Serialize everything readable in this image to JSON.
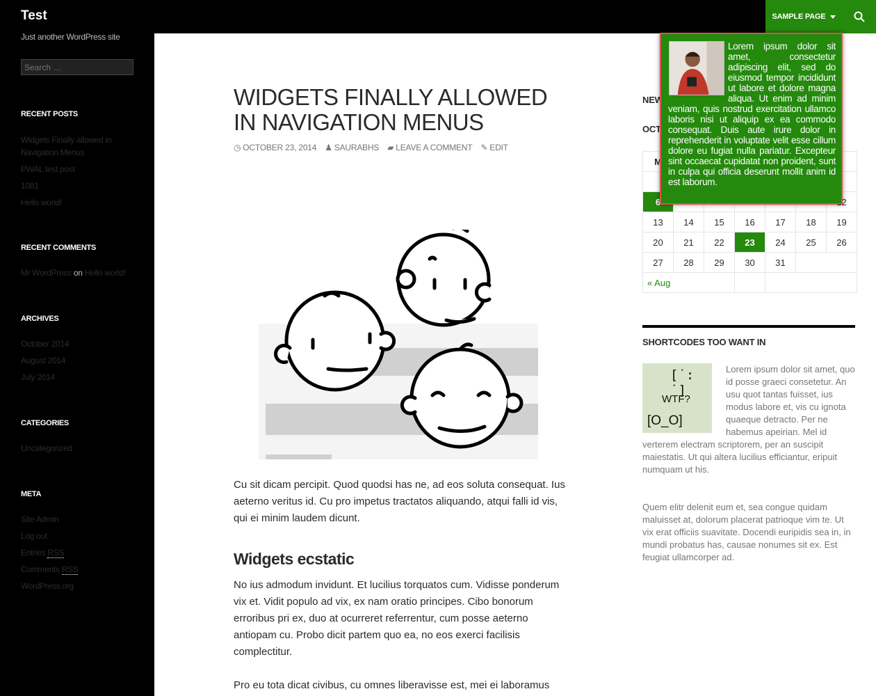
{
  "header": {
    "site_title": "Test",
    "tagline": "Just another WordPress site",
    "nav_item": "SAMPLE PAGE",
    "search_icon": "search-icon"
  },
  "sidebar": {
    "search_placeholder": "Search …",
    "recent_posts": {
      "title": "RECENT POSTS",
      "items": [
        "Widgets Finally allowed in Navigation Menus",
        "PWAL test post",
        "1081",
        "Hello world!"
      ]
    },
    "recent_comments": {
      "title": "RECENT COMMENTS",
      "author": "Mr WordPress",
      "on": "on",
      "post": "Hello world!"
    },
    "archives": {
      "title": "ARCHIVES",
      "items": [
        "October 2014",
        "August 2014",
        "July 2014"
      ]
    },
    "categories": {
      "title": "CATEGORIES",
      "items": [
        "Uncategorized"
      ]
    },
    "meta": {
      "title": "META",
      "site_admin": "Site Admin",
      "log_out": "Log out",
      "entries": "Entries",
      "comments": "Comments",
      "rss": "RSS",
      "wordpress_org": "WordPress.org"
    }
  },
  "post": {
    "title": "WIDGETS FINALLY ALLOWED IN NAVIGATION MENUS",
    "date": "OCTOBER 23, 2014",
    "author": "SAURABHS",
    "comment": "LEAVE A COMMENT",
    "edit": "EDIT",
    "para1": "Cu sit dicam percipit. Quod quodsi has ne, ad eos soluta consequat. Ius aeterno veritus id. Cu pro impetus tractatos aliquando, atqui falli id vis, qui ei minim laudem dicunt.",
    "heading": "Widgets ecstatic",
    "para2": "No ius admodum invidunt. Et lucilius torquatos cum. Vidisse ponderum vix et. Vidit populo ad vix, ex nam oratio principes. Cibo bonorum erroribus pri ex, duo at ocurreret referrentur, cum posse aeterno antiopam cu. Probo dicit partem quo ea, no eos exerci facilisis complectitur.",
    "para3": "Pro eu tota dicat civibus, cu omnes liberavisse est, mei ei laboramus"
  },
  "right": {
    "new_title_partial": "NEW",
    "oct_partial": "OCT",
    "calendar": {
      "header_partial": "M",
      "row_week2_first": "6",
      "row_week2_last": "12",
      "weeks": [
        [
          "13",
          "14",
          "15",
          "16",
          "17",
          "18",
          "19"
        ],
        [
          "20",
          "21",
          "22",
          "23",
          "24",
          "25",
          "26"
        ],
        [
          "27",
          "28",
          "29",
          "30",
          "31",
          "",
          ""
        ]
      ],
      "today": "23",
      "prev_link": "« Aug"
    },
    "shortcodes_title": "SHORTCODES TOO WANT IN",
    "wtf": {
      "face1": "[˙: ˙]",
      "label": "WTF?",
      "face2": "[O_O]"
    },
    "sc_para1": "Lorem ipsum dolor sit amet, quo id posse graeci consetetur. An usu quot tantas fuisset, ius modus labore et, vis cu ignota quaeque detracto. Per ne habemus apeirian. Mel id verterem electram scriptorem, per an suscipit maiestatis. Ut qui altera lucilius efficiantur, eripuit numquam ut his.",
    "sc_para2": "Quem elitr delenit eum et, sea congue quidam maluisset at, dolorum placerat patrioque vim te. Ut vix erat officiis suavitate. Docendi euripidis sea in, in mundi probatus has, causae nonumes sit ex. Est feugiat ullamcorper ad."
  },
  "popup": {
    "text": "Lorem ipsum dolor sit amet, consectetur adipiscing elit, sed do eiusmod tempor incididunt ut labore et dolore magna aliqua. Ut enim ad minim veniam, quis nostrud exercitation ullamco laboris nisi ut aliquip ex ea commodo consequat. Duis aute irure dolor in reprehenderit in voluptate velit esse cillum dolore eu fugiat nulla pariatur. Excepteur sint occaecat cupidatat non proident, sunt in culpa qui officia deserunt mollit anim id est laborum.",
    "avatar_icon": "avatar-photo"
  },
  "colors": {
    "accent": "#24890d",
    "sidebar_bg": "#000000",
    "popup_border": "#d9534f"
  }
}
